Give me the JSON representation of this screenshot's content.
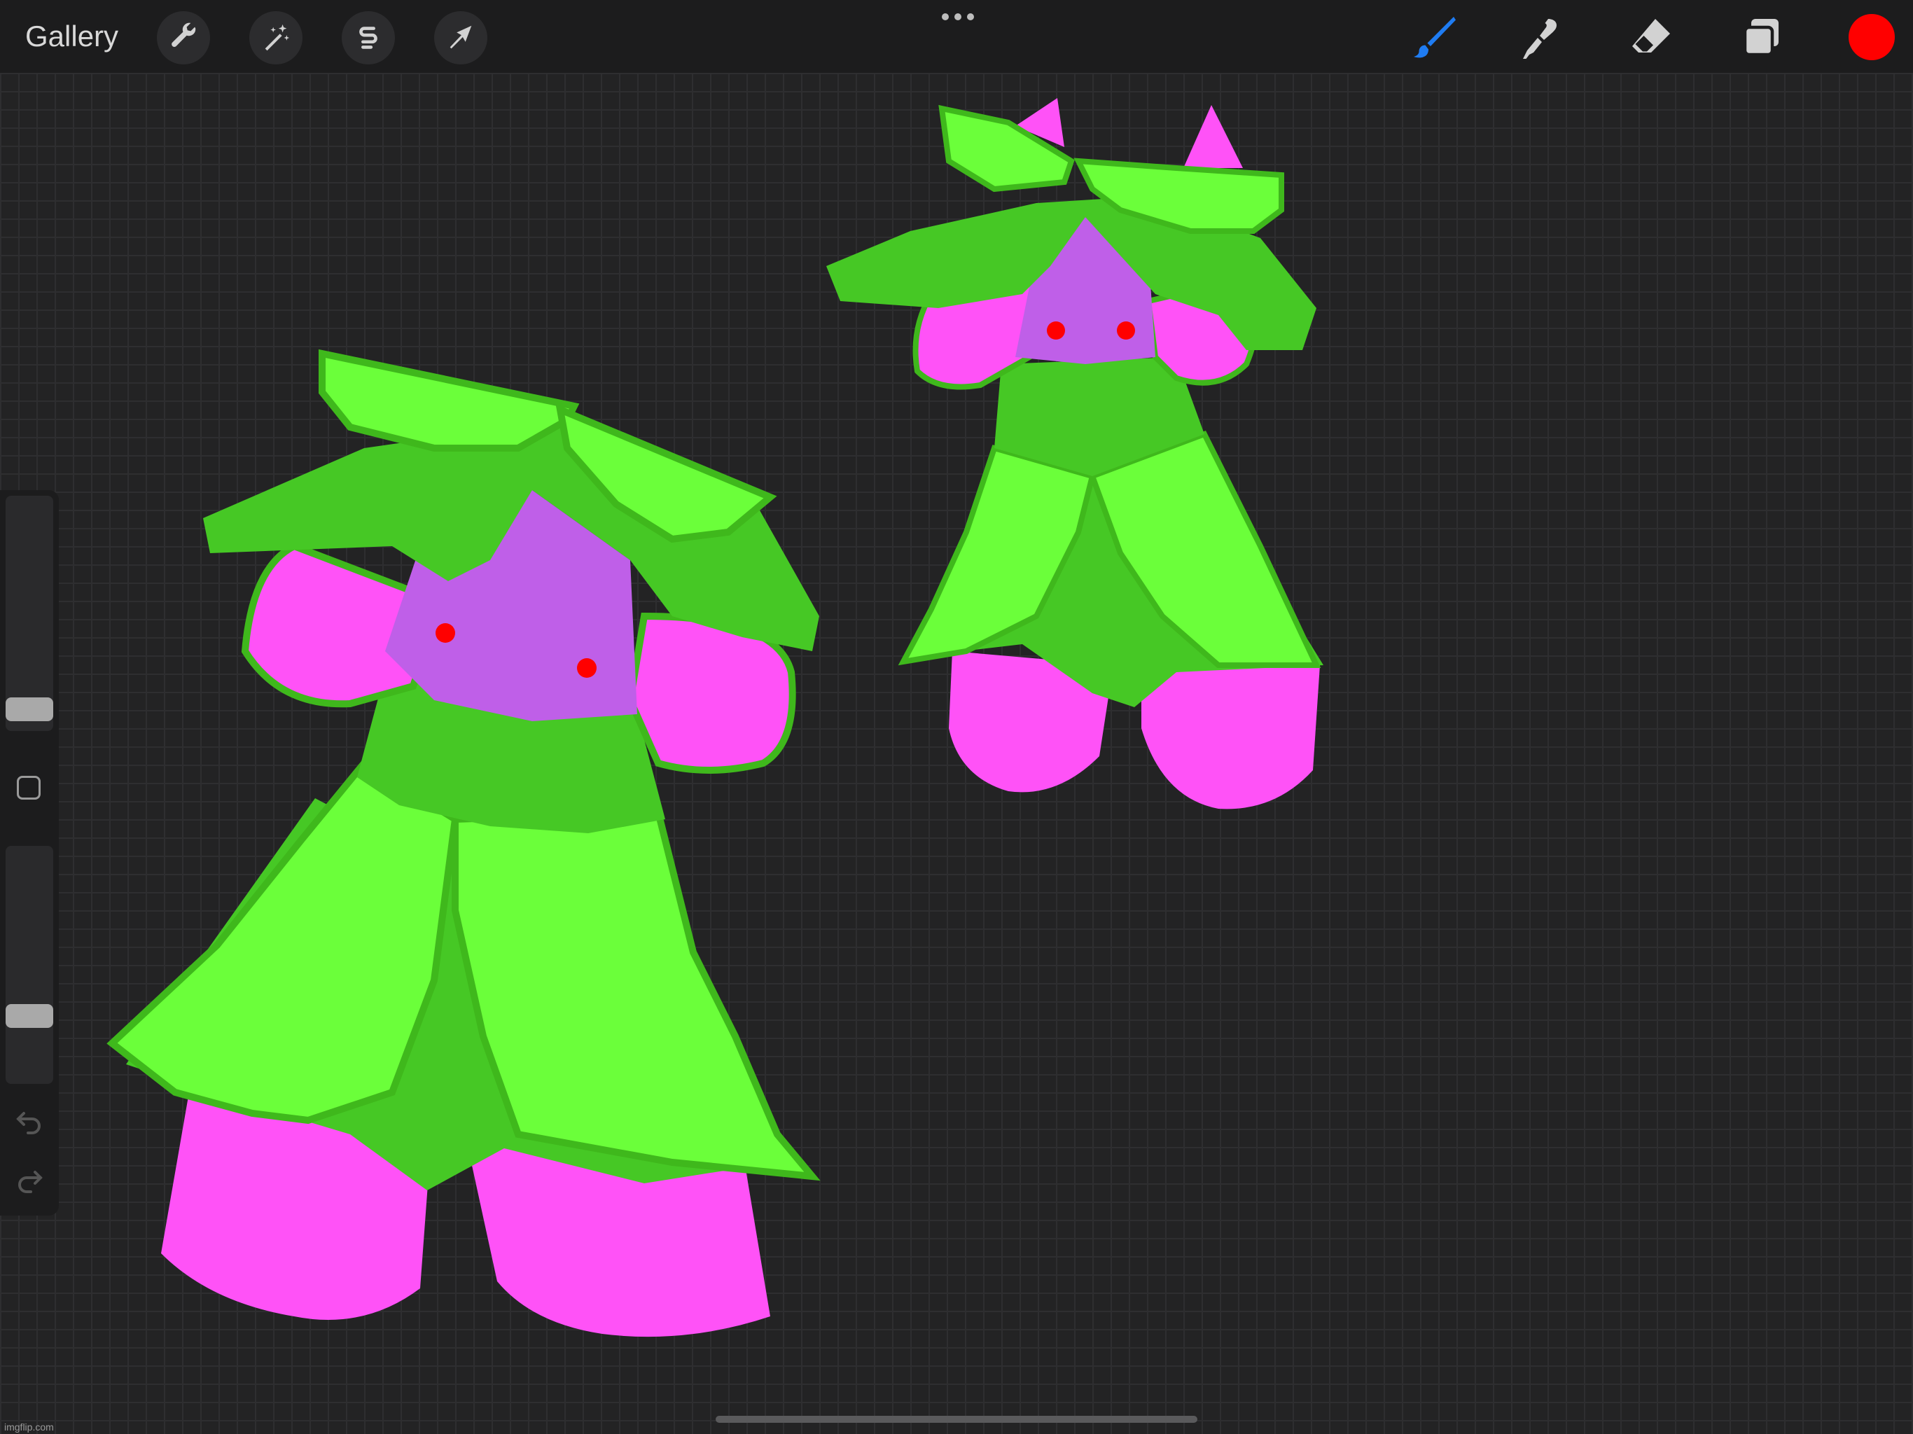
{
  "app": {
    "gallery_label": "Gallery"
  },
  "toolbar": {
    "left_icons": [
      "wrench-icon",
      "magic-wand-icon",
      "selection-icon",
      "transform-arrow-icon"
    ],
    "more_icon": "more-dots-icon",
    "right_icons": [
      "brush-icon",
      "smudge-icon",
      "eraser-icon",
      "layers-icon"
    ],
    "brush_active_color": "#1f7cf2",
    "current_color": "#ff0000"
  },
  "sidebar": {
    "brush_size_level": 0.15,
    "opacity_level": 0.3,
    "undo_icon": "undo-icon",
    "redo_icon": "redo-icon"
  },
  "palette": {
    "light_green": "#6bff3a",
    "dark_green": "#46c825",
    "outline_green": "#3fb81c",
    "pink": "#ff52f7",
    "purple": "#bf5fe8",
    "red": "#ff0000"
  },
  "footer": {
    "watermark": "imgflip.com"
  }
}
